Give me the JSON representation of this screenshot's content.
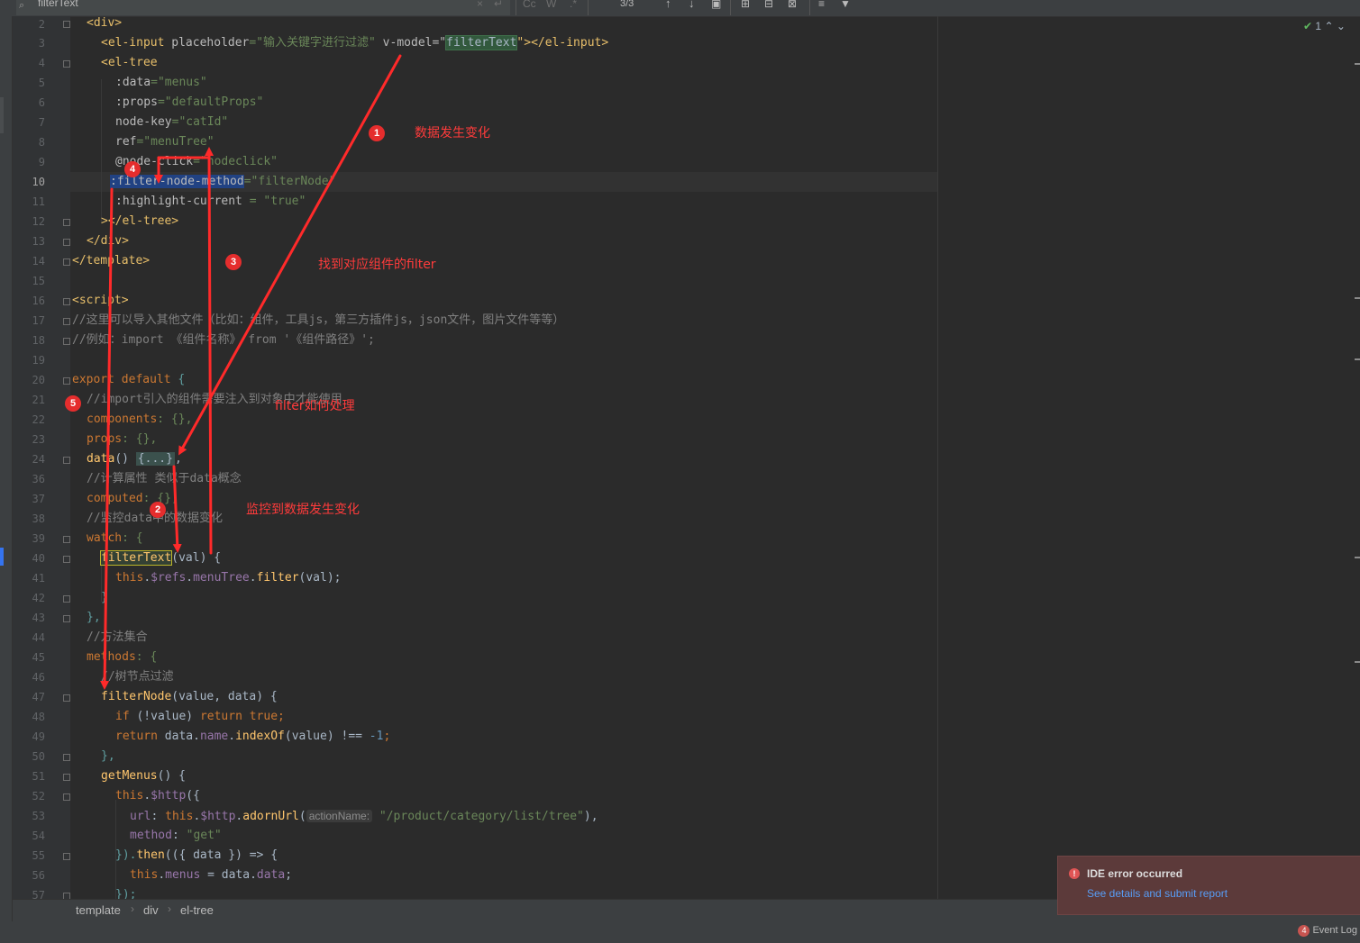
{
  "find_bar": {
    "query": "filterText",
    "match_count": "3/3",
    "match_case_label": "Cc",
    "words_label": "W",
    "regex_label": ".*"
  },
  "line_numbers": [
    "2",
    "3",
    "4",
    "5",
    "6",
    "7",
    "8",
    "9",
    "10",
    "11",
    "12",
    "13",
    "14",
    "15",
    "16",
    "17",
    "18",
    "19",
    "20",
    "21",
    "22",
    "23",
    "24",
    "36",
    "37",
    "38",
    "39",
    "40",
    "41",
    "42",
    "43",
    "44",
    "45",
    "46",
    "47",
    "48",
    "49",
    "50",
    "51",
    "52",
    "53",
    "54",
    "55",
    "56",
    "57"
  ],
  "code": {
    "l2": "<div>",
    "l3a": "<el-input ",
    "l3b": "placeholder",
    "l3c": "=\"输入关键字进行过滤\"",
    "l3d": " v-model=\"",
    "l3e": "filterText",
    "l3f": "\"></el-input>",
    "l4": "<el-tree",
    "l5a": ":data",
    "l5b": "=\"menus\"",
    "l6a": ":props",
    "l6b": "=\"defaultProps\"",
    "l7a": "node-key",
    "l7b": "=\"catId\"",
    "l8a": "ref",
    "l8b": "=\"menuTree\"",
    "l9a": "@node-click",
    "l9b": "=\"nodeclick\"",
    "l10a": ":filter-node-method",
    "l10b": "=\"filterNode\"",
    "l11a": ":highlight-current",
    "l11b": " = \"true\"",
    "l12": "></el-tree>",
    "l13": "</div>",
    "l14": "</template>",
    "l16": "<script>",
    "l17": "//这里可以导入其他文件（比如：组件，工具js，第三方插件js，json文件，图片文件等等）",
    "l18": "//例如：import 《组件名称》 from '《组件路径》';",
    "l20a": "export default",
    "l20b": " {",
    "l21": "//import引入的组件需要注入到对象中才能使用",
    "l22a": "components",
    "l22b": ": {},",
    "l23a": "props",
    "l23b": ": {},",
    "l24a": "data",
    "l24b": "() ",
    "l24c": "{...}",
    "l24d": ",",
    "l36": "//计算属性 类似于data概念",
    "l37a": "computed",
    "l37b": ": {},",
    "l38": "//监控data中的数据变化",
    "l39a": "watch",
    "l39b": ": {",
    "l40a": "filterText",
    "l40b": "(val) {",
    "l41a": "this",
    "l41b": ".",
    "l41c": "$refs",
    "l41d": ".",
    "l41e": "menuTree",
    "l41f": ".",
    "l41g": "filter",
    "l41h": "(val);",
    "l42": "}",
    "l43": "},",
    "l44": "//方法集合",
    "l45a": "methods",
    "l45b": ": {",
    "l46": "//树节点过滤",
    "l47a": "filterNode",
    "l47b": "(value, data) {",
    "l48a": "if",
    "l48b": " (!value) ",
    "l48c": "return true",
    "l48d": ";",
    "l49a": "return",
    "l49b": " data.",
    "l49c": "name",
    "l49d": ".",
    "l49e": "indexOf",
    "l49f": "(value) !== ",
    "l49g": "-1",
    "l49h": ";",
    "l50": "},",
    "l51a": "getMenus",
    "l51b": "() {",
    "l52a": "this",
    "l52b": ".",
    "l52c": "$http",
    "l52d": "({",
    "l53a": "url",
    "l53b": ": ",
    "l53c": "this",
    "l53d": ".",
    "l53e": "$http",
    "l53f": ".",
    "l53g": "adornUrl",
    "l53h": "(",
    "l53hint": "actionName:",
    "l53i": " \"/product/category/list/tree\"",
    "l53j": "),",
    "l54a": "method",
    "l54b": ": ",
    "l54c": "\"get\"",
    "l55a": "}).",
    "l55b": "then",
    "l55c": "(({ data }) => {",
    "l56a": "this",
    "l56b": ".",
    "l56c": "menus",
    "l56d": " = data.",
    "l56e": "data",
    "l56f": ";",
    "l57": "});"
  },
  "inspection": {
    "count": "1"
  },
  "annotations": {
    "step1": "1",
    "step2": "2",
    "step3": "3",
    "step4": "4",
    "step5": "5",
    "text1": "数据发生变化",
    "text2": "监控到数据发生变化",
    "text3": "找到对应组件的filter",
    "text5": "filter如何处理"
  },
  "breadcrumbs": [
    "template",
    "div",
    "el-tree"
  ],
  "error_toast": {
    "title": "IDE error occurred",
    "link": "See details and submit report"
  },
  "event_log": {
    "count": "4",
    "label": "Event Log"
  },
  "colors": {
    "annotation": "#ff3b3b",
    "keyword": "#cc7832",
    "string": "#6a8759",
    "tag": "#e8bf6a"
  }
}
